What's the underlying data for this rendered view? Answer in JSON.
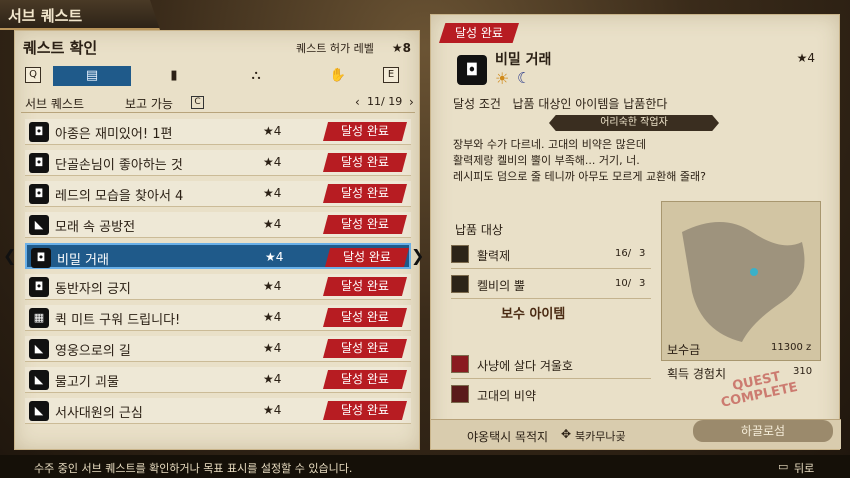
{
  "screen_title": "서브 퀘스트",
  "left": {
    "heading": "퀘스트 확인",
    "permit_label": "퀘스트 허가 레벨",
    "permit_value": "★8",
    "key_left": "Q",
    "key_right": "E",
    "tab_icons": [
      "book-icon",
      "card-icon",
      "hierarchy-icon",
      "handshake-icon"
    ],
    "sub_label": "서브 퀘스트",
    "report_label": "보고 가능",
    "report_key": "C",
    "page": "11/ 19",
    "rows": [
      {
        "icon": "◘",
        "name": "아종은 재미있어! 1편",
        "stars": "★4",
        "status": "달성 완료"
      },
      {
        "icon": "◘",
        "name": "단골손님이 좋아하는 것",
        "stars": "★4",
        "status": "달성 완료"
      },
      {
        "icon": "◘",
        "name": "레드의 모습을 찾아서 4",
        "stars": "★4",
        "status": "달성 완료"
      },
      {
        "icon": "◣",
        "name": "모래 속 공방전",
        "stars": "★4",
        "status": "달성 완료"
      },
      {
        "icon": "◘",
        "name": "비밀 거래",
        "stars": "★4",
        "status": "달성 완료"
      },
      {
        "icon": "◘",
        "name": "동반자의 긍지",
        "stars": "★4",
        "status": "달성 완료"
      },
      {
        "icon": "▦",
        "name": "퀵 미트 구워 드립니다!",
        "stars": "★4",
        "status": "달성 완료"
      },
      {
        "icon": "◣",
        "name": "영웅으로의 길",
        "stars": "★4",
        "status": "달성 완료"
      },
      {
        "icon": "◣",
        "name": "물고기 괴물",
        "stars": "★4",
        "status": "달성 완료"
      },
      {
        "icon": "◣",
        "name": "서사대원의 근심",
        "stars": "★4",
        "status": "달성 완료"
      }
    ],
    "selected_index": 4
  },
  "right": {
    "status_badge": "달성 완료",
    "quest_name": "비밀 거래",
    "stars": "★4",
    "condition_label": "달성 조건",
    "condition_text": "납품 대상인 아이템을 납품한다",
    "client": "어리숙한 작업자",
    "description": [
      "장부와 수가 다르네. 고대의 비약은 많은데",
      "활력제랑 켈비의 뿔이 부족해... 거기, 너.",
      "레시피도 덤으로 줄 테니까 아무도 모르게 교환해 줄래?"
    ],
    "delivery_label": "납품 대상",
    "delivery": [
      {
        "name": "활력제",
        "count": "16/",
        "req": "3"
      },
      {
        "name": "켈비의 뿔",
        "count": "10/",
        "req": "3"
      }
    ],
    "reward_label": "보수 아이템",
    "rewards": [
      "사냥에 살다 겨울호",
      "고대의 비약"
    ],
    "money_label": "보수금",
    "money_value": "11300 z",
    "exp_label": "획득 경험치",
    "exp_value": "310",
    "stamp": "QUEST COMPLETE",
    "taxi_label": "야옹택시 목적지",
    "taxi_dest": "북카무나곶",
    "location_button": "하끌로섬"
  },
  "footer": {
    "hint": "수주 중인 서브 퀘스트를 확인하거나 목표 표시를 설정할 수 있습니다.",
    "back": "뒤로"
  }
}
